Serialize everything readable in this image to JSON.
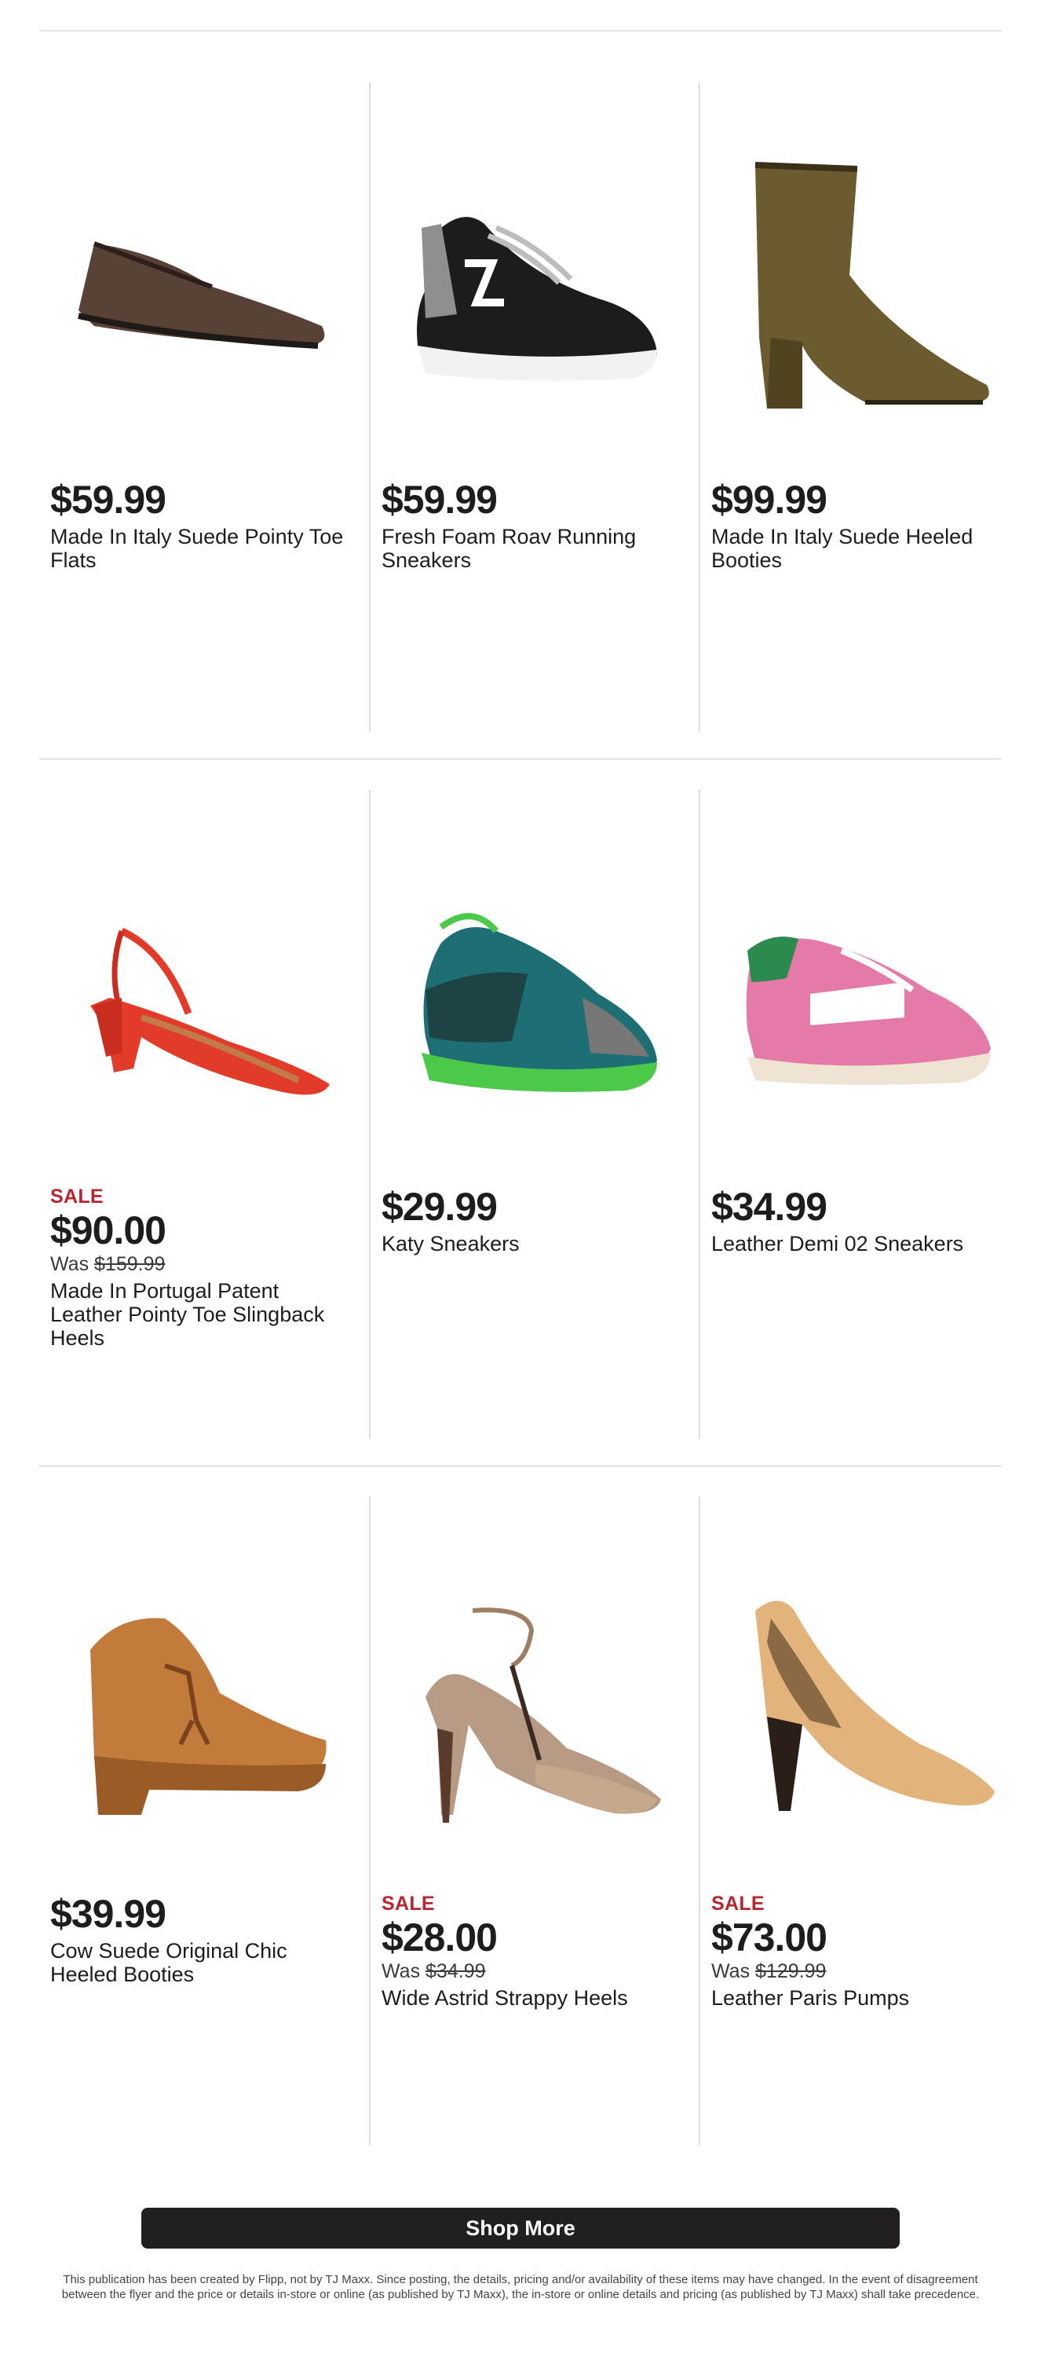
{
  "products": [
    {
      "sale": "",
      "price": "$59.99",
      "was_prefix": "",
      "was_price": "",
      "name": "Made In Italy Suede Pointy Toe Flats",
      "icon": "suede-flat-shoe-icon",
      "colors": {
        "main": "#5a4138",
        "sole": "#1e1a18"
      }
    },
    {
      "sale": "",
      "price": "$59.99",
      "was_prefix": "",
      "was_price": "",
      "name": "Fresh Foam Roav Running Sneakers",
      "icon": "running-sneaker-icon",
      "colors": {
        "main": "#1c1c1c",
        "sole": "#f2f2f2"
      }
    },
    {
      "sale": "",
      "price": "$99.99",
      "was_prefix": "",
      "was_price": "",
      "name": "Made In Italy Suede Heeled Booties",
      "icon": "heeled-bootie-icon",
      "colors": {
        "main": "#6b5b2e",
        "sole": "#2a2418"
      }
    },
    {
      "sale": "SALE",
      "price": "$90.00",
      "was_prefix": "Was ",
      "was_price": "$159.99",
      "name": "Made In Portugal Patent Leather Pointy Toe Slingback Heels",
      "icon": "slingback-heel-icon",
      "colors": {
        "main": "#e23b2a",
        "sole": "#b4271b"
      }
    },
    {
      "sale": "",
      "price": "$29.99",
      "was_prefix": "",
      "was_price": "",
      "name": "Katy Sneakers",
      "icon": "mesh-sneaker-icon",
      "colors": {
        "main": "#1d6f73",
        "sole": "#4cc84a"
      }
    },
    {
      "sale": "",
      "price": "$34.99",
      "was_prefix": "",
      "was_price": "",
      "name": "Leather Demi 02 Sneakers",
      "icon": "leather-sneaker-icon",
      "colors": {
        "main": "#e47aa8",
        "sole": "#efe4d3"
      }
    },
    {
      "sale": "",
      "price": "$39.99",
      "was_prefix": "",
      "was_price": "",
      "name": "Cow Suede Original Chic Heeled Booties",
      "icon": "clog-bootie-icon",
      "colors": {
        "main": "#c27b3b",
        "sole": "#9a5b27"
      }
    },
    {
      "sale": "SALE",
      "price": "$28.00",
      "was_prefix": "Was ",
      "was_price": "$34.99",
      "name": "Wide Astrid Strappy Heels",
      "icon": "strappy-heel-icon",
      "colors": {
        "main": "#b79a83",
        "sole": "#5a3a2a"
      }
    },
    {
      "sale": "SALE",
      "price": "$73.00",
      "was_prefix": "Was ",
      "was_price": "$129.99",
      "name": "Leather Paris Pumps",
      "icon": "pump-heel-icon",
      "colors": {
        "main": "#e2b47c",
        "sole": "#2a1f18"
      }
    }
  ],
  "shop_more": "Shop More",
  "disclaimer": "This publication has been created by Flipp, not by TJ Maxx. Since posting, the details, pricing and/or availability of these items may have changed. In the event of disagreement between the flyer and the price or details in-store or online (as published by TJ Maxx), the in-store or online details and pricing (as published by TJ Maxx) shall take precedence.",
  "colors": {
    "sale_red": "#b7252f",
    "button_bg": "#231f20",
    "divider": "#e4e4e4"
  }
}
